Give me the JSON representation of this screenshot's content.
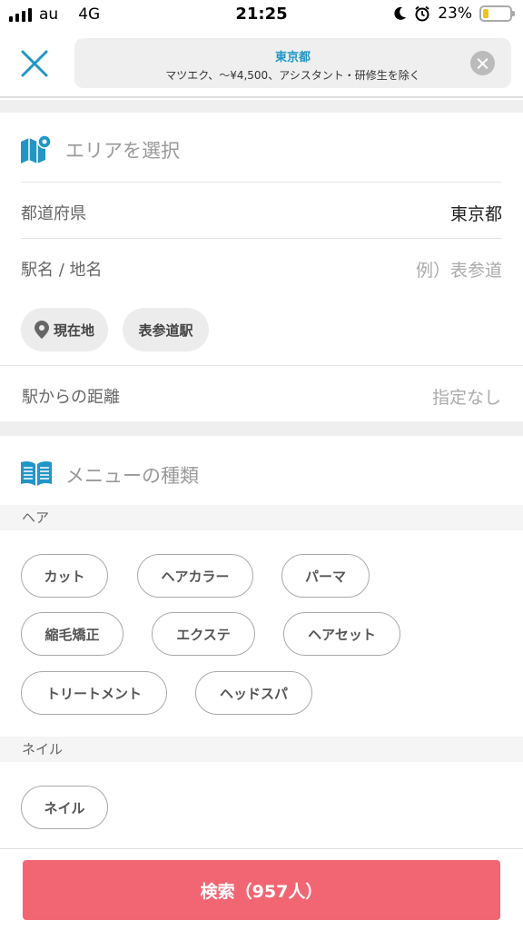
{
  "status_bar": {
    "carrier": "au",
    "network": "4G",
    "time": "21:25",
    "battery_percent": "23%",
    "battery_level": 0.23
  },
  "header": {
    "search_title": "東京都",
    "search_summary": "マツエク、〜¥4,500、アシスタント・研修生を除く"
  },
  "area_section": {
    "title": "エリアを選択",
    "prefecture_label": "都道府県",
    "prefecture_value": "東京都",
    "station_label": "駅名 / 地名",
    "station_placeholder": "例）表参道",
    "chips": [
      "現在地",
      "表参道駅"
    ],
    "distance_label": "駅からの距離",
    "distance_value": "指定なし"
  },
  "menu_section": {
    "title": "メニューの種類",
    "hair_category": "ヘア",
    "hair_items": [
      "カット",
      "ヘアカラー",
      "パーマ",
      "縮毛矯正",
      "エクステ",
      "ヘアセット",
      "トリートメント",
      "ヘッドスパ"
    ],
    "nail_category": "ネイル",
    "nail_items": [
      "ネイル"
    ]
  },
  "footer": {
    "search_button": "検索（957人）"
  },
  "colors": {
    "accent_blue": "#2196c6",
    "search_button": "#f26673",
    "battery": "#f0c31d"
  }
}
